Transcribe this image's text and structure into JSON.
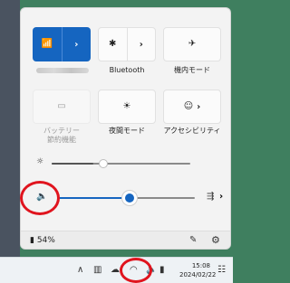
{
  "colors": {
    "accent": "#1565c0",
    "highlight": "#e0141e",
    "panel": "#f3f3f3"
  },
  "quick_settings": {
    "wifi_tile": {
      "icon": "wifi-icon",
      "chevron": "›",
      "name_label": "",
      "state": "on"
    },
    "bluetooth_tile": {
      "icon": "bluetooth-icon",
      "chevron": "›",
      "label": "Bluetooth",
      "state": "off"
    },
    "airplane_tile": {
      "icon": "airplane-icon",
      "label": "機内モード",
      "state": "off"
    },
    "battery_saver_tile": {
      "icon": "battery-saver-icon",
      "label": "バッテリー\n節約機能",
      "state": "disabled"
    },
    "night_light_tile": {
      "icon": "night-light-icon",
      "label": "夜間モード",
      "state": "off"
    },
    "accessibility_tile": {
      "icon": "accessibility-icon",
      "chevron": "›",
      "label": "アクセシビリティ",
      "state": "off"
    },
    "brightness": {
      "icon": "brightness-icon",
      "level": 0.3
    },
    "volume": {
      "icon": "speaker-icon",
      "level": 0.55,
      "output_icon": "audio-output-icon",
      "output_chevron": "›"
    },
    "footer": {
      "battery_icon": "battery-icon",
      "battery_text": "54%",
      "edit_icon": "pencil-icon",
      "settings_icon": "gear-icon"
    }
  },
  "taskbar": {
    "icons": [
      "chevron-up-icon",
      "tablet-icon",
      "cloud-icon",
      "wifi-icon",
      "speaker-icon",
      "battery-icon"
    ],
    "time": "15:08",
    "date": "2024/02/22",
    "notification_icon": "notification-icon"
  }
}
